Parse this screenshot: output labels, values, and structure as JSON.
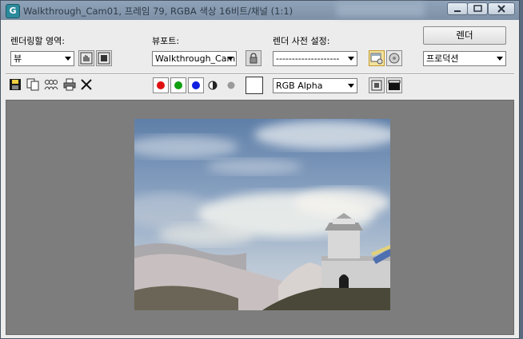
{
  "window": {
    "title": "Walkthrough_Cam01, 프레임 79, RGBA 색상 16비트/채널 (1:1)"
  },
  "area_to_render": {
    "label": "렌더링할 영역:",
    "value": "뷰"
  },
  "viewport": {
    "label": "뷰포트:",
    "value": "Walkthrough_Cam"
  },
  "render_preset": {
    "label": "렌더 사전 설정:",
    "value": "--------------------"
  },
  "render_button": {
    "label": "렌더"
  },
  "production": {
    "value": "프로덕션"
  },
  "channel": {
    "value": "RGB Alpha"
  },
  "colors": {
    "red": "#e01010",
    "green": "#10a010",
    "blue": "#1020e0",
    "swatch": "#ffffff"
  }
}
